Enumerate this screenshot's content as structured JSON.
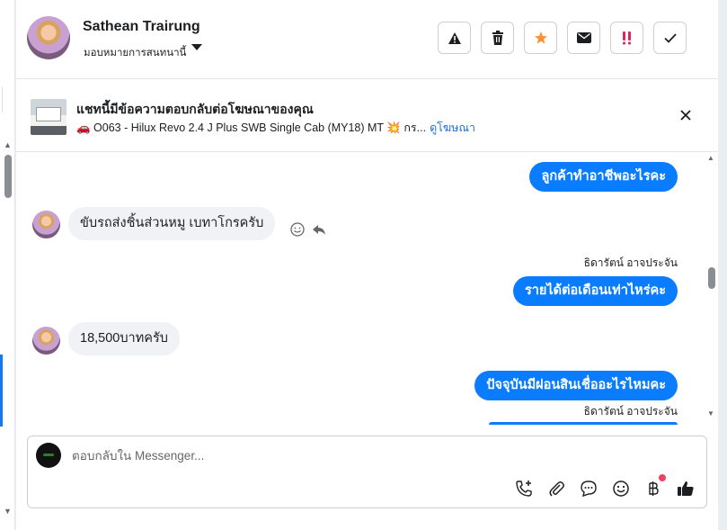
{
  "header": {
    "name": "Sathean Trairung",
    "assign_label": "มอบหมายการสนทนานี้"
  },
  "actions": [
    {
      "name": "report-button",
      "icon": "warning-icon"
    },
    {
      "name": "delete-button",
      "icon": "trash-icon"
    },
    {
      "name": "star-button",
      "icon": "star-icon"
    },
    {
      "name": "mark-unread-button",
      "icon": "envelope-icon"
    },
    {
      "name": "important-button",
      "icon": "double-exclamation-icon"
    },
    {
      "name": "done-button",
      "icon": "check-icon"
    }
  ],
  "ad": {
    "title": "แชทนี้มีข้อความตอบกลับต่อโฆษณาของคุณ",
    "subtitle": "🚗 O063 - Hilux Revo 2.4 J Plus SWB Single Cab (MY18) MT 💥 กร...",
    "link": "ดูโฆษณา"
  },
  "messages": {
    "m1": "ลูกค้าทำอาชีพอะไรคะ",
    "m2": "ขับรถส่งชิ้นส่วนหมู เบทาโกรครับ",
    "sender1": "ธิดารัตน์ อาจประจัน",
    "m3": "รายได้ต่อเดือนเท่าไหร่คะ",
    "m4": "18,500บาทครับ",
    "m5": "ปัจจุบันมีผ่อนสินเชื่ออะไรไหมคะ",
    "sender2": "ธิดารัตน์ อาจประจัน"
  },
  "composer": {
    "placeholder": "ตอบกลับใน Messenger..."
  },
  "tools": [
    "call-add-icon",
    "paperclip-icon",
    "saved-reply-icon",
    "emoji-icon",
    "baht-icon",
    "thumbs-up-icon"
  ],
  "colors": {
    "accent": "#0a7cff",
    "link": "#216fdb",
    "star": "#f7923b",
    "important": "#e0245e"
  }
}
